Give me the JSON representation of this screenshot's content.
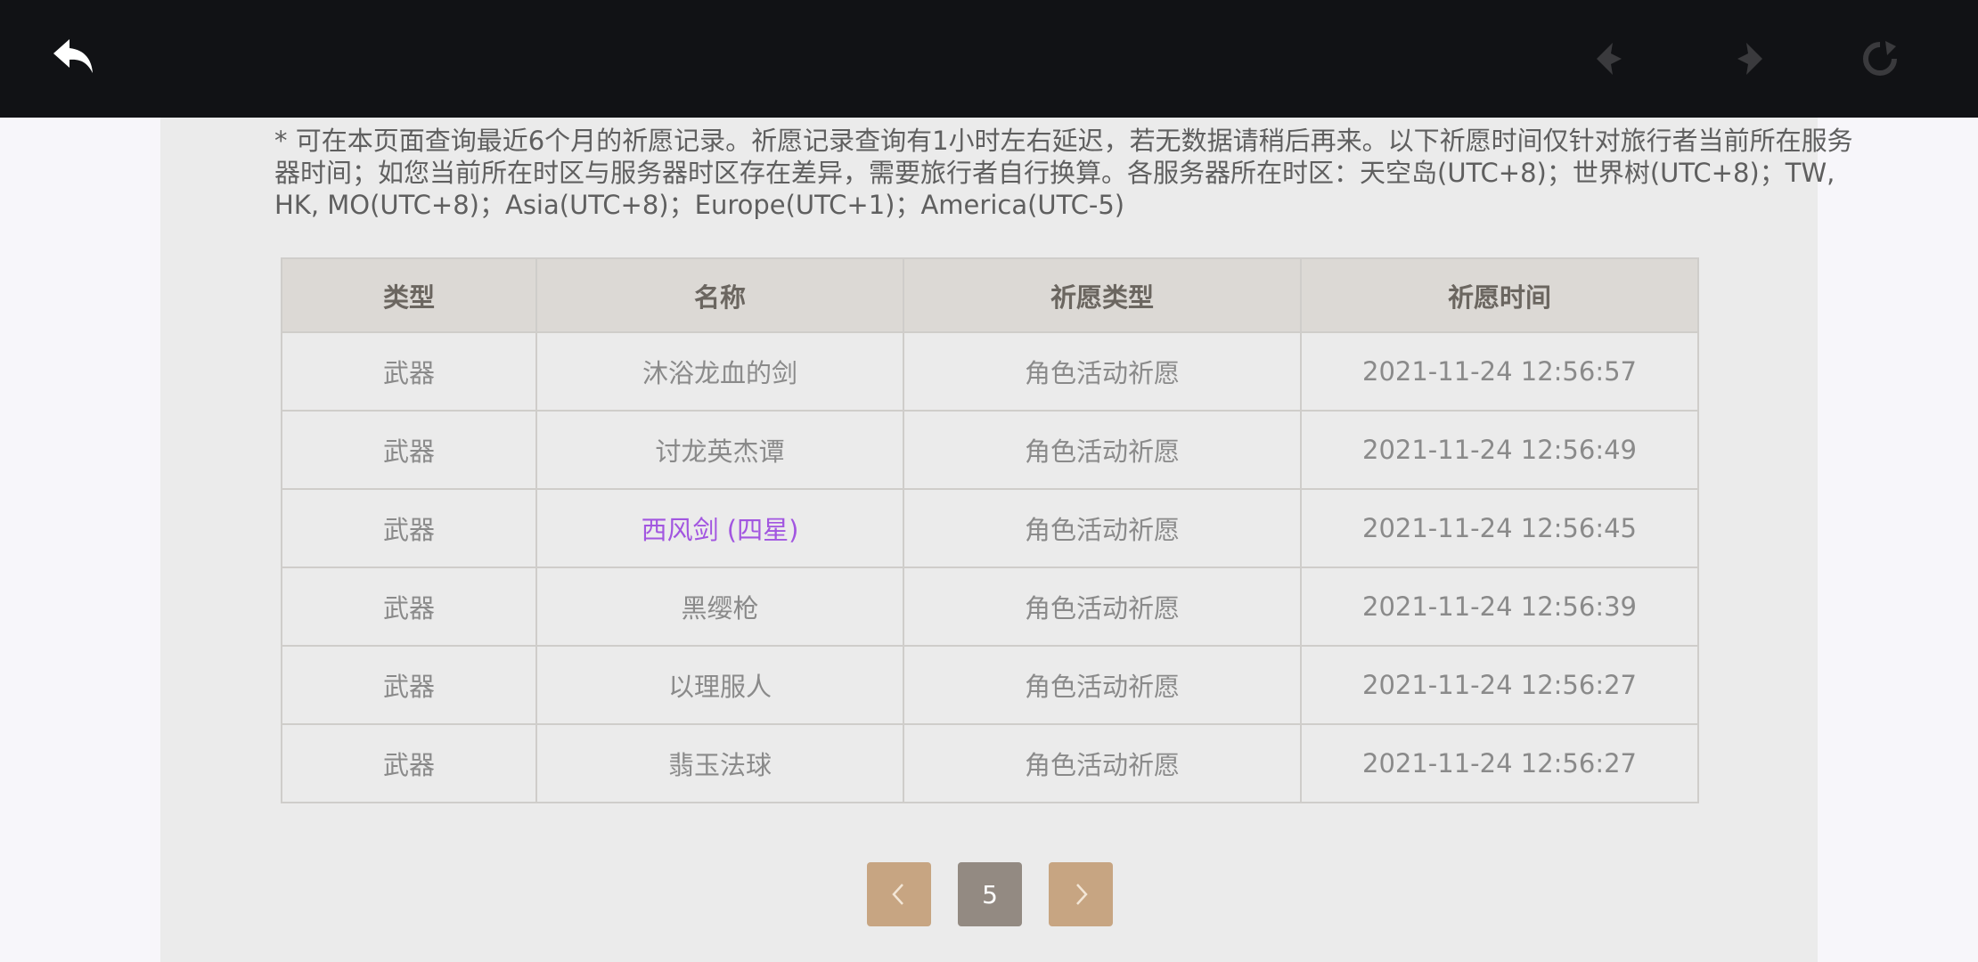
{
  "toolbar": {
    "icons": [
      "back-arrow-icon",
      "diamond-left-icon",
      "diamond-right-icon",
      "reload-icon"
    ]
  },
  "notice": {
    "text": "* 可在本页面查询最近6个月的祈愿记录。祈愿记录查询有1小时左右延迟，若无数据请稍后再来。以下祈愿时间仅针对旅行者当前所在服务器时间；如您当前所在时区与服务器时区存在差异，需要旅行者自行换算。各服务器所在时区：天空岛(UTC+8)；世界树(UTC+8)；TW, HK, MO(UTC+8)；Asia(UTC+8)；Europe(UTC+1)；America(UTC-5)"
  },
  "table": {
    "headers": [
      "类型",
      "名称",
      "祈愿类型",
      "祈愿时间"
    ],
    "rows": [
      {
        "type": "武器",
        "name": "沐浴龙血的剑",
        "wish": "角色活动祈愿",
        "time": "2021-11-24 12:56:57"
      },
      {
        "type": "武器",
        "name": "讨龙英杰谭",
        "wish": "角色活动祈愿",
        "time": "2021-11-24 12:56:49"
      },
      {
        "type": "武器",
        "name": "西风剑 (四星)",
        "wish": "角色活动祈愿",
        "time": "2021-11-24 12:56:45"
      },
      {
        "type": "武器",
        "name": "黑缨枪",
        "wish": "角色活动祈愿",
        "time": "2021-11-24 12:56:39"
      },
      {
        "type": "武器",
        "name": "以理服人",
        "wish": "角色活动祈愿",
        "time": "2021-11-24 12:56:27"
      },
      {
        "type": "武器",
        "name": "翡玉法球",
        "wish": "角色活动祈愿",
        "time": "2021-11-24 12:56:27"
      }
    ]
  },
  "pagination": {
    "current": "5"
  },
  "colors": {
    "topbar": "#111215",
    "panel": "#ebebeb",
    "header_bg": "#dcd9d5",
    "four_star": "#a256e0",
    "pager_btn": "#c7a582",
    "pager_current": "#938a82"
  }
}
